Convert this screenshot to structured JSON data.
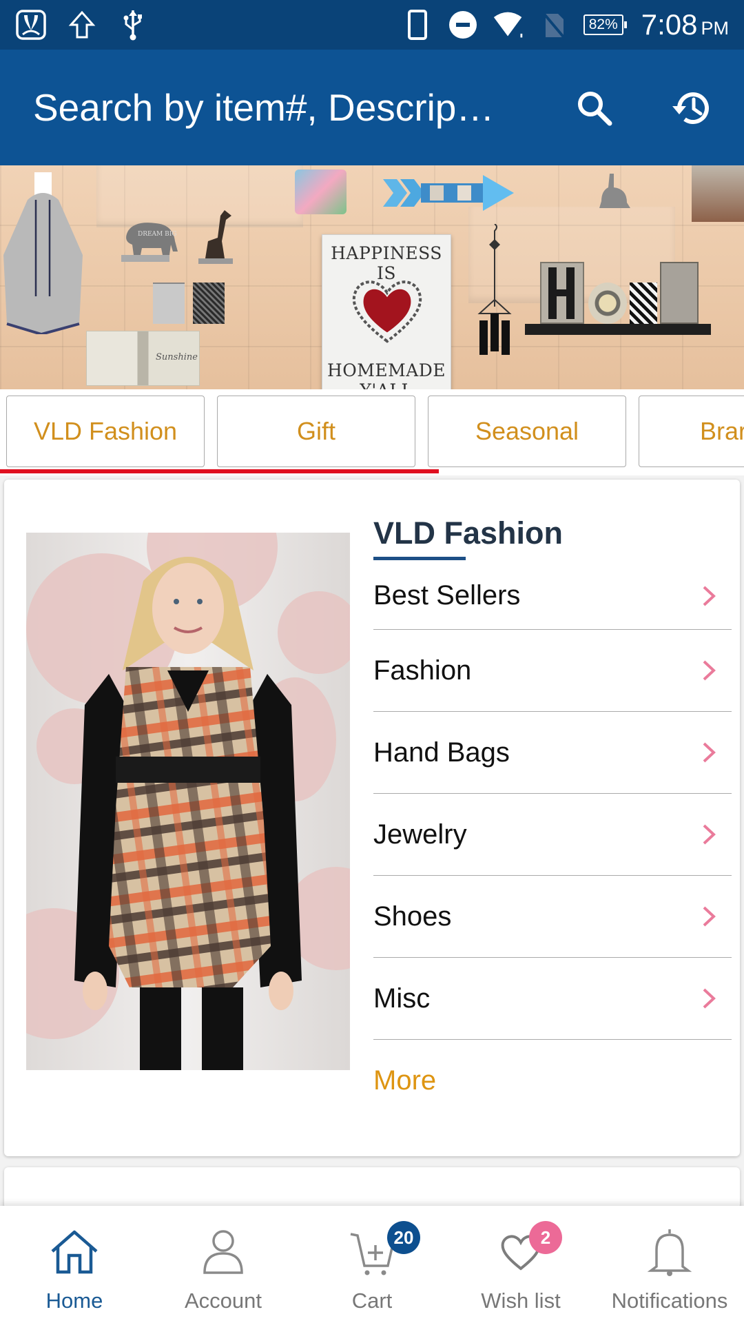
{
  "status_bar": {
    "left_icons": [
      "saavn-app-icon",
      "upload-icon",
      "usb-icon"
    ],
    "right_icons": [
      "phone-icon",
      "do-not-disturb-icon",
      "wifi-icon",
      "no-sim-icon"
    ],
    "battery": "82%",
    "time": "7:08",
    "ampm": "PM"
  },
  "search": {
    "placeholder": "Search by item#, Descrip…",
    "search_icon": "search-icon",
    "history_icon": "history-icon"
  },
  "banner": {
    "sign_top": "HAPPINESS IS",
    "sign_bottom": "HOMEMADE Y'ALL",
    "elephant_text": "DREAM BIG",
    "pillow_text": "Sunshine",
    "home_letters": "HOME"
  },
  "tabs": {
    "items": [
      {
        "label": "VLD Fashion"
      },
      {
        "label": "Gift"
      },
      {
        "label": "Seasonal"
      },
      {
        "label": "Brar"
      }
    ],
    "active_index": 0,
    "scroll_progress": 0.59
  },
  "category_card": {
    "title": "VLD Fashion",
    "items": [
      {
        "label": "Best Sellers"
      },
      {
        "label": "Fashion"
      },
      {
        "label": "Hand Bags"
      },
      {
        "label": "Jewelry"
      },
      {
        "label": "Shoes"
      },
      {
        "label": "Misc"
      }
    ],
    "more_label": "More"
  },
  "bottom_nav": {
    "items": [
      {
        "label": "Home",
        "icon": "home-icon",
        "active": true
      },
      {
        "label": "Account",
        "icon": "account-icon"
      },
      {
        "label": "Cart",
        "icon": "cart-icon",
        "badge": "20"
      },
      {
        "label": "Wish list",
        "icon": "heart-icon",
        "badge": "2"
      },
      {
        "label": "Notifications",
        "icon": "bell-icon"
      }
    ]
  },
  "colors": {
    "status_bar": "#0a4378",
    "header": "#0d5394",
    "tab_text": "#d18f1d",
    "tab_indicator": "#e01020",
    "title": "#233447",
    "chevron": "#ea7b9b",
    "more": "#de9512",
    "cart_badge": "#0d4f8f",
    "wishlist_badge": "#ec6a97",
    "nav_active": "#1a5a94"
  }
}
